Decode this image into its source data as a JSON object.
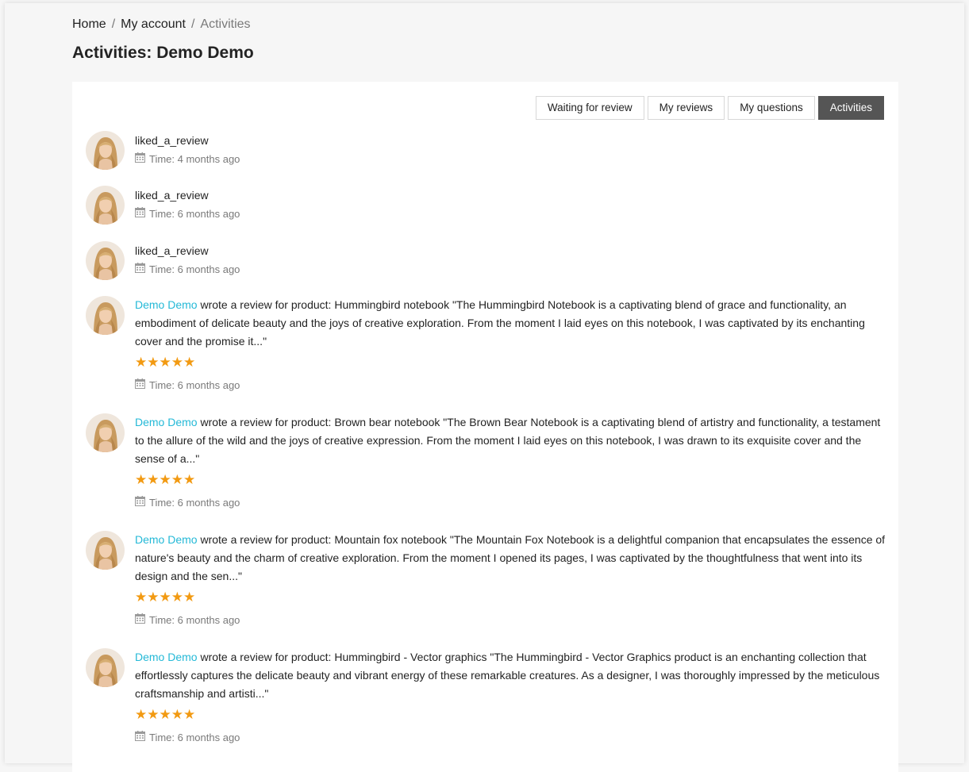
{
  "breadcrumb": {
    "home": "Home",
    "account": "My account",
    "current": "Activities"
  },
  "page_title": "Activities: Demo Demo",
  "tabs": [
    {
      "label": "Waiting for review",
      "active": false
    },
    {
      "label": "My reviews",
      "active": false
    },
    {
      "label": "My questions",
      "active": false
    },
    {
      "label": "Activities",
      "active": true
    }
  ],
  "colors": {
    "accent_link": "#24b9d7",
    "star": "#f29a12",
    "active_tab": "#555555"
  },
  "activities": [
    {
      "text": "liked_a_review",
      "time": "Time: 4 months ago"
    },
    {
      "text": "liked_a_review",
      "time": "Time: 6 months ago"
    },
    {
      "text": "liked_a_review",
      "time": "Time: 6 months ago"
    },
    {
      "author": "Demo Demo",
      "text": " wrote a review for product: Hummingbird notebook \"The Hummingbird Notebook is a captivating blend of grace and functionality, an embodiment of delicate beauty and the joys of creative exploration. From the moment I laid eyes on this notebook, I was captivated by its enchanting cover and the promise it...\"",
      "stars": "★★★★★",
      "time": "Time: 6 months ago"
    },
    {
      "author": "Demo Demo",
      "text": " wrote a review for product: Brown bear notebook \"The Brown Bear Notebook is a captivating blend of artistry and functionality, a testament to the allure of the wild and the joys of creative expression. From the moment I laid eyes on this notebook, I was drawn to its exquisite cover and the sense of a...\"",
      "stars": "★★★★★",
      "time": "Time: 6 months ago"
    },
    {
      "author": "Demo Demo",
      "text": " wrote a review for product: Mountain fox notebook \"The Mountain Fox Notebook is a delightful companion that encapsulates the essence of nature's beauty and the charm of creative exploration. From the moment I opened its pages, I was captivated by the thoughtfulness that went into its design and the sen...\"",
      "stars": "★★★★★",
      "time": "Time: 6 months ago"
    },
    {
      "author": "Demo Demo",
      "text": " wrote a review for product: Hummingbird - Vector graphics \"The Hummingbird - Vector Graphics product is an enchanting collection that effortlessly captures the delicate beauty and vibrant energy of these remarkable creatures. As a designer, I was thoroughly impressed by the meticulous craftsmanship and artisti...\"",
      "stars": "★★★★★",
      "time": "Time: 6 months ago"
    }
  ]
}
